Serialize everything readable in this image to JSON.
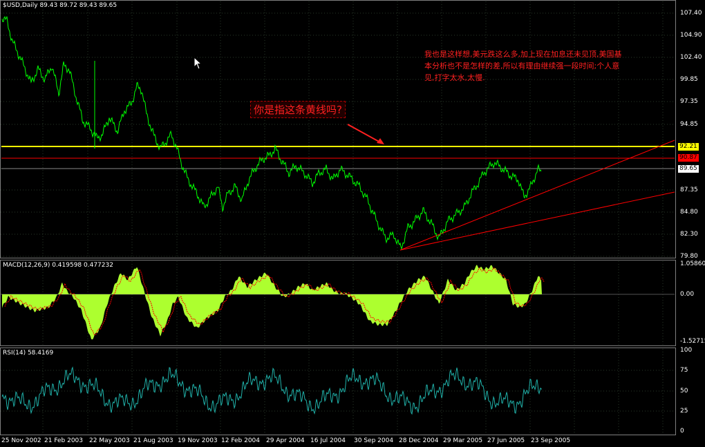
{
  "main_chart": {
    "header": "$USD,Daily  89.43 89.72 89.43 89.65",
    "price_axis": [
      "107.40",
      "104.90",
      "102.40",
      "99.85",
      "97.35",
      "94.85",
      "92.21",
      "90.87",
      "89.65",
      "87.35",
      "84.80",
      "82.30",
      "79.80"
    ],
    "yellow_line_value": "92.21",
    "red_line_value": "90.87",
    "current_value": "89.65",
    "colors": {
      "price": "#00ff00",
      "yellow_line": "#ffff00",
      "red_line": "#ff0000",
      "grid": "#1e2a1e"
    }
  },
  "annotations": {
    "question_box": "你是指这条黄线吗?",
    "note": "我也是这样想,美元跌这么多,加上现在加息还未见顶,美国基本分析也不是怎样的差,所以有理由继续强一段时间;个人意见,打字太水,太慢."
  },
  "macd": {
    "header": "MACD(12,26,9)  0.419598  0.477232",
    "axis": [
      "1.05860",
      "0.00",
      "-1.52715"
    ],
    "colors": {
      "histogram": "#adff2f",
      "signal": "#ff0000"
    }
  },
  "rsi": {
    "header": "RSI(14)  58.4169",
    "axis": [
      "100",
      "75",
      "50",
      "25",
      "0"
    ],
    "colors": {
      "line": "#20b2aa"
    }
  },
  "dates": [
    "25 Nov 2002",
    "21 Feb 2003",
    "22 May 2003",
    "21 Aug 2003",
    "19 Nov 2003",
    "12 Feb 2004",
    "29 Apr 2004",
    "16 Jul 2004",
    "30 Sep 2004",
    "28 Dec 2004",
    "29 Mar 2005",
    "27 Jun 2005",
    "23 Sep 2005"
  ]
}
